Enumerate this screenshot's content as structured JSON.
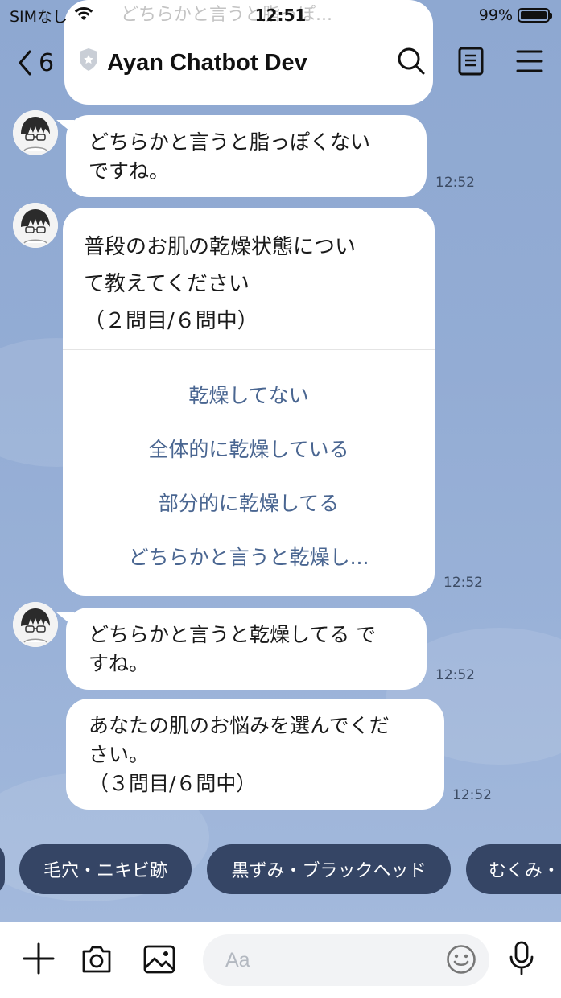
{
  "status_bar": {
    "carrier": "SIMなし",
    "time": "12:51",
    "battery": "99%",
    "battery_level": 0.99
  },
  "header": {
    "back_count": "6",
    "title": "Ayan Chatbot Dev",
    "icons": [
      "search-icon",
      "notes-icon",
      "menu-icon"
    ]
  },
  "partial_message": {
    "text": "どちらかと言うと脂っぽ..."
  },
  "messages": [
    {
      "text_line1": "どちらかと言うと脂っぽくない",
      "text_line2": "ですね。",
      "time": "12:52"
    },
    {
      "question_line1": "普段のお肌の乾燥状態につい",
      "question_line2": "て教えてください",
      "question_line3": "（２問目/６問中）",
      "options": [
        "乾燥してない",
        "全体的に乾燥している",
        "部分的に乾燥してる",
        "どちらかと言うと乾燥し..."
      ],
      "time": "12:52"
    },
    {
      "text_line1": "どちらかと言うと乾燥してる で",
      "text_line2": "すね。",
      "time": "12:52"
    },
    {
      "text_line1": "あなたの肌のお悩みを選んでくだ",
      "text_line2": "さい。",
      "text_line3": "（３問目/６問中）",
      "time": "12:52"
    }
  ],
  "quick_replies": [
    "毛穴・ニキビ跡",
    "黒ずみ・ブラックヘッド",
    "むくみ・"
  ],
  "input": {
    "placeholder": "Aa"
  },
  "colors": {
    "background": "#8fa9d2",
    "chip": "#354565",
    "option_text": "#4a6691"
  }
}
